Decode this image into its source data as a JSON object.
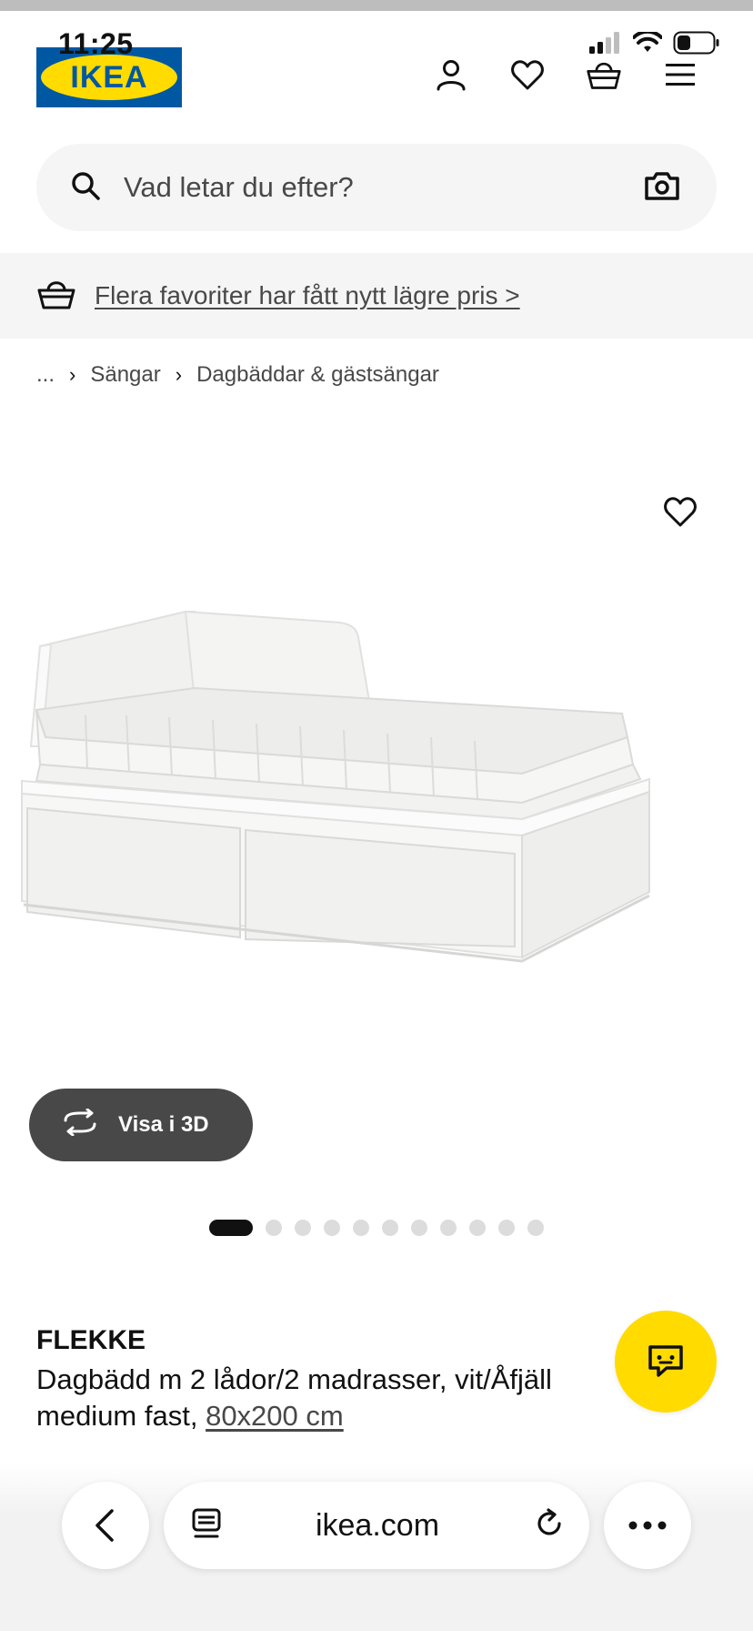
{
  "status_bar": {
    "time": "11:25"
  },
  "header": {
    "logo_text": "IKEA",
    "icons": [
      "account-icon",
      "heart-icon",
      "basket-icon",
      "menu-icon"
    ]
  },
  "search": {
    "placeholder": "Vad letar du efter?"
  },
  "promo": {
    "link_text": "Flera favoriter har fått nytt lägre pris >"
  },
  "breadcrumb": {
    "items": [
      "...",
      "Sängar",
      "Dagbäddar & gästsängar"
    ]
  },
  "gallery": {
    "view_3d_label": "Visa i 3D",
    "image_count": 12,
    "active_index": 0
  },
  "product": {
    "name": "FLEKKE",
    "description": "Dagbädd m 2 lådor/2 madrasser, vit/Åfjäll medium fast,",
    "size": "80x200 cm"
  },
  "browser": {
    "url": "ikea.com"
  },
  "colors": {
    "ikea_blue": "#0058a3",
    "ikea_yellow": "#ffdb00",
    "dark_grey": "#484848"
  }
}
